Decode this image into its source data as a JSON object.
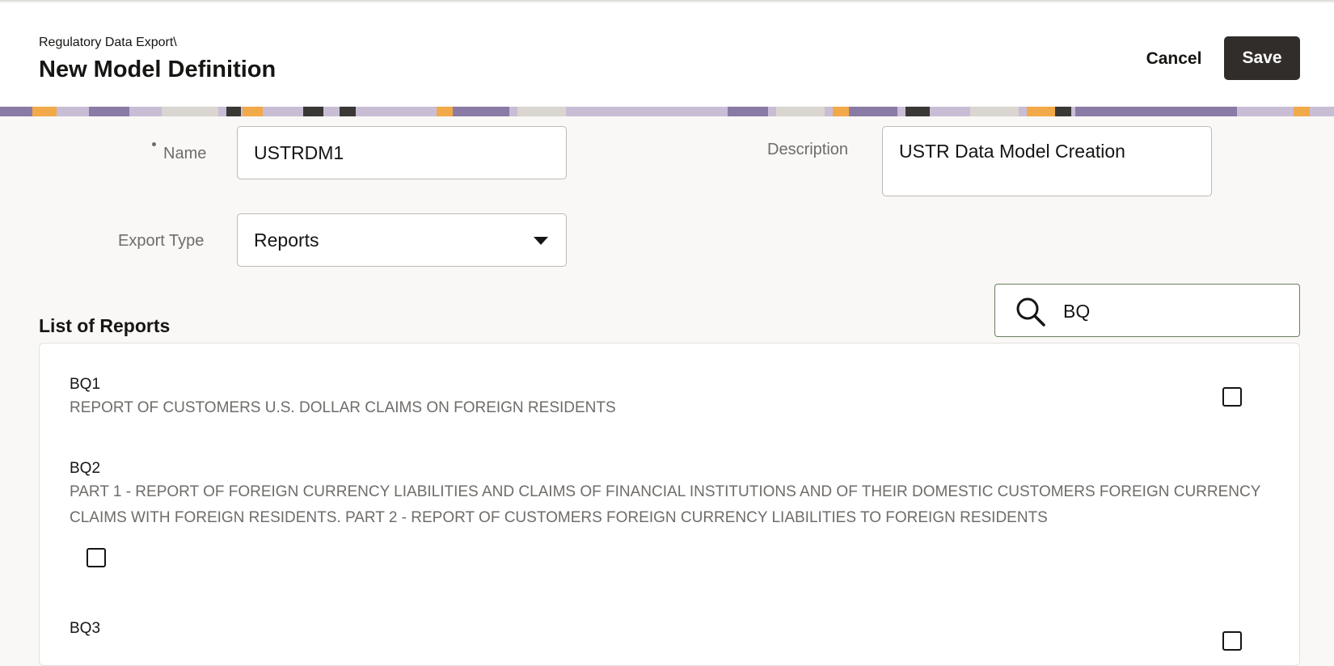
{
  "header": {
    "breadcrumb": "Regulatory Data Export\\",
    "title": "New Model Definition",
    "cancel_label": "Cancel",
    "save_label": "Save"
  },
  "form": {
    "name_label": "Name",
    "name_value": "USTRDM1",
    "description_label": "Description",
    "description_value": "USTR Data Model Creation",
    "export_type_label": "Export Type",
    "export_type_value": "Reports"
  },
  "list": {
    "title": "List of Reports",
    "search_value": "BQ",
    "items": [
      {
        "code": "BQ1",
        "description": "REPORT OF CUSTOMERS U.S. DOLLAR CLAIMS ON FOREIGN RESIDENTS",
        "checked": false
      },
      {
        "code": "BQ2",
        "description": "PART 1 - REPORT OF FOREIGN CURRENCY LIABILITIES AND CLAIMS OF FINANCIAL INSTITUTIONS AND OF THEIR DOMESTIC CUSTOMERS FOREIGN CURRENCY CLAIMS WITH FOREIGN RESIDENTS. PART 2 - REPORT OF CUSTOMERS FOREIGN CURRENCY LIABILITIES TO FOREIGN RESIDENTS",
        "checked": false
      },
      {
        "code": "BQ3",
        "description": "",
        "checked": false
      }
    ]
  },
  "colors": {
    "primary_button": "#312d2a",
    "page_background": "#f9f8f6",
    "search_border": "#6a7f5b"
  },
  "icons": [
    "search-icon",
    "dropdown-caret-icon",
    "checkbox-icon"
  ]
}
